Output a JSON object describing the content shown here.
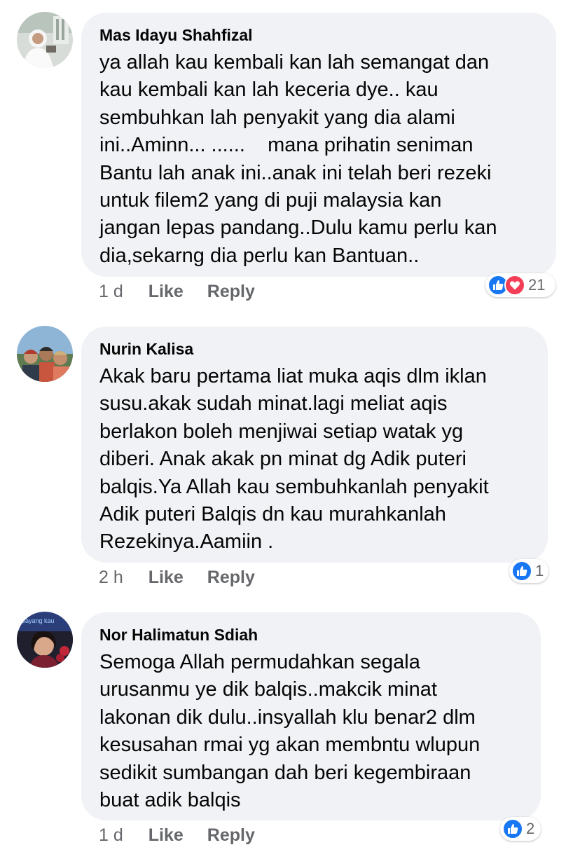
{
  "comments": [
    {
      "author": "Mas Idayu Shahfizal",
      "text": "ya allah kau kembali kan lah semangat dan\nkau kembali kan lah keceria dye.. kau\nsembuhkan lah penyakit yang dia alami\nini..Aminn... ......    mana prihatin seniman\nBantu lah anak ini..anak ini telah beri rezeki\nuntuk filem2 yang di puji malaysia kan\njangan lepas pandang..Dulu kamu perlu kan\ndia,sekarng dia perlu kan Bantuan..",
      "time": "1 d",
      "like_label": "Like",
      "reply_label": "Reply",
      "reactions": [
        "like-icon",
        "love-icon"
      ],
      "reaction_count": "21"
    },
    {
      "author": "Nurin Kalisa",
      "text": "Akak baru pertama liat muka aqis dlm iklan\nsusu.akak sudah minat.lagi meliat aqis\nberlakon boleh menjiwai setiap watak yg\ndiberi. Anak akak pn minat dg Adik puteri\nbalqis.Ya Allah kau sembuhkanlah penyakit\nAdik puteri Balqis dn kau murahkanlah\nRezekinya.Aamiin .",
      "time": "2 h",
      "like_label": "Like",
      "reply_label": "Reply",
      "reactions": [
        "like-icon"
      ],
      "reaction_count": "1"
    },
    {
      "author": "Nor Halimatun Sdiah",
      "avatar_text": "Sayang kau",
      "text": "Semoga Allah permudahkan segala\nurusanmu ye dik balqis..makcik minat\nlakonan dik dulu..insyallah klu benar2 dlm\nkesusahan rmai yg akan membntu wlupun\nsedikit sumbangan dah beri kegembiraan\nbuat adik balqis",
      "time": "1 d",
      "like_label": "Like",
      "reply_label": "Reply",
      "reactions": [
        "like-icon"
      ],
      "reaction_count": "2"
    }
  ],
  "colors": {
    "bubble": "#f0f2f5",
    "like_blue": "#1877f2",
    "love_red": "#f33e58",
    "secondary_text": "#65676b"
  }
}
